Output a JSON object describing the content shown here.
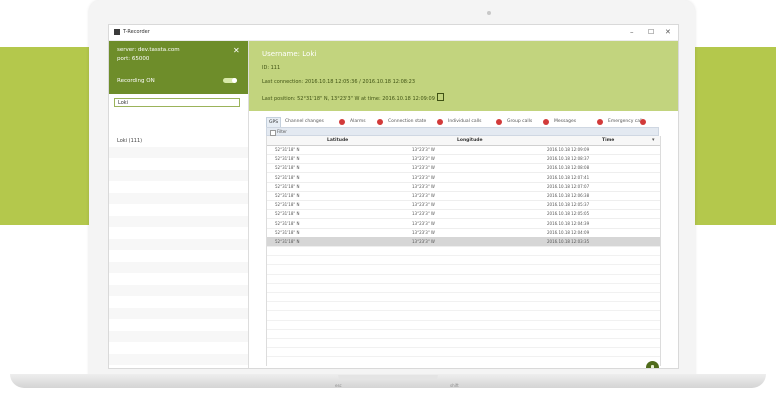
{
  "window": {
    "title": "T-Recorder",
    "controls": {
      "minimize": "–",
      "maximize": "☐",
      "close": "✕"
    }
  },
  "server": {
    "address": "server: dev.tassta.com",
    "port": "port: 65000",
    "recording_label": "Recording ON",
    "recording_on": true,
    "close_glyph": "✕"
  },
  "search": {
    "value": "Loki"
  },
  "users": [
    {
      "label": "Loki (111)"
    }
  ],
  "user": {
    "username": "Username: Loki",
    "id": "ID: 111",
    "last_connection": "Last connection: 2016.10.18 12:05:36 / 2016.10.18 12:08:23",
    "last_position": "Last position: 52°31'18\" N, 13°23'3\" W at time: 2016.10.18 12:09:09"
  },
  "tabs": [
    {
      "label": "GPS",
      "active": true,
      "closable": false
    },
    {
      "label": "Channel changes",
      "active": false,
      "closable": true
    },
    {
      "label": "Alarms",
      "active": false,
      "closable": true
    },
    {
      "label": "Connection state",
      "active": false,
      "closable": true
    },
    {
      "label": "Individual calls",
      "active": false,
      "closable": true
    },
    {
      "label": "Group calls",
      "active": false,
      "closable": true
    },
    {
      "label": "Messages",
      "active": false,
      "closable": true
    },
    {
      "label": "Emergency calls",
      "active": false,
      "closable": true
    }
  ],
  "filter_label": "Filter",
  "table": {
    "columns": [
      "Latitude",
      "Longitude",
      "Time"
    ],
    "sort_indicator": "▾",
    "rows": [
      {
        "lat": "52°31'18\" N",
        "lon": "13°23'3\" W",
        "time": "2016.10.18 12:09:09",
        "selected": false
      },
      {
        "lat": "52°31'18\" N",
        "lon": "13°23'3\" W",
        "time": "2016.10.18 12:08:37",
        "selected": false
      },
      {
        "lat": "52°31'18\" N",
        "lon": "13°23'3\" W",
        "time": "2016.10.18 12:08:08",
        "selected": false
      },
      {
        "lat": "52°31'18\" N",
        "lon": "13°23'3\" W",
        "time": "2016.10.18 12:07:41",
        "selected": false
      },
      {
        "lat": "52°31'18\" N",
        "lon": "13°23'3\" W",
        "time": "2016.10.18 12:07:07",
        "selected": false
      },
      {
        "lat": "52°31'18\" N",
        "lon": "13°23'3\" W",
        "time": "2016.10.18 12:06:38",
        "selected": false
      },
      {
        "lat": "52°31'18\" N",
        "lon": "13°23'3\" W",
        "time": "2016.10.18 12:05:37",
        "selected": false
      },
      {
        "lat": "52°31'18\" N",
        "lon": "13°23'3\" W",
        "time": "2016.10.18 12:05:05",
        "selected": false
      },
      {
        "lat": "52°31'18\" N",
        "lon": "13°23'3\" W",
        "time": "2016.10.18 12:04:39",
        "selected": false
      },
      {
        "lat": "52°31'18\" N",
        "lon": "13°23'3\" W",
        "time": "2016.10.18 12:04:09",
        "selected": false
      },
      {
        "lat": "52°31'18\" N",
        "lon": "13°23'3\" W",
        "time": "2016.10.18 12:03:35",
        "selected": true
      }
    ]
  },
  "laptop": {
    "base_left": "esc",
    "base_right": "shift"
  },
  "colors": {
    "accent_band": "#b4c84c",
    "server_panel": "#6e8d2a",
    "user_header": "#c2d47e",
    "tab_close": "#d23a3a",
    "fab": "#4f6b1b"
  },
  "icons": {
    "app": "app-logo-icon",
    "copy": "copy-icon",
    "tab_close": "close-circle-icon",
    "fab": "info-icon",
    "toggle": "toggle-switch-icon"
  }
}
